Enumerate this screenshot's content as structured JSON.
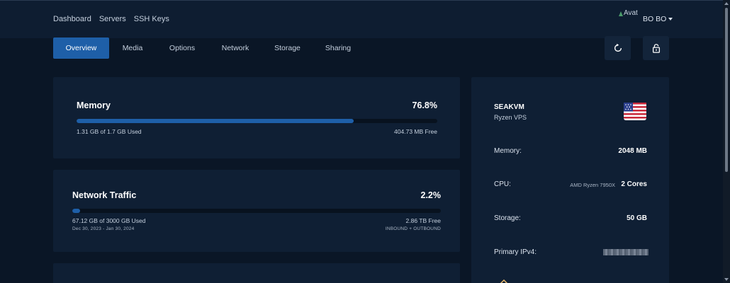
{
  "topnav": {
    "items": [
      {
        "label": "Dashboard"
      },
      {
        "label": "Servers"
      },
      {
        "label": "SSH Keys"
      }
    ],
    "avatar_alt": "Avat",
    "user": "BO BO"
  },
  "tabs": [
    {
      "label": "Overview",
      "active": true
    },
    {
      "label": "Media"
    },
    {
      "label": "Options"
    },
    {
      "label": "Network"
    },
    {
      "label": "Storage"
    },
    {
      "label": "Sharing"
    }
  ],
  "actions": {
    "refresh_icon": "refresh-icon",
    "lock_icon": "lock-icon"
  },
  "memory": {
    "title": "Memory",
    "percent": "76.8%",
    "fill_percent": 76.8,
    "used": "1.31 GB of 1.7 GB Used",
    "free": "404.73 MB Free"
  },
  "traffic": {
    "title": "Network Traffic",
    "percent": "2.2%",
    "fill_percent": 2.2,
    "used": "67.12 GB of 3000 GB Used",
    "remaining": "2.86 TB Free",
    "period": "Dec 30, 2023 - Jan 30, 2024",
    "direction": "INBOUND + OUTBOUND"
  },
  "server": {
    "name": "SEAKVM",
    "plan": "Ryzen VPS",
    "flag_icon": "us-flag-icon",
    "memory_label": "Memory:",
    "memory_value": "2048 MB",
    "cpu_label": "CPU:",
    "cpu_model": "AMD Ryzen 7950X",
    "cpu_value": "2 Cores",
    "storage_label": "Storage:",
    "storage_value": "50 GB",
    "ipv4_label": "Primary IPv4:"
  },
  "colors": {
    "accent": "#1e5fa8",
    "background": "#0a1626",
    "card": "#0f1f34"
  }
}
